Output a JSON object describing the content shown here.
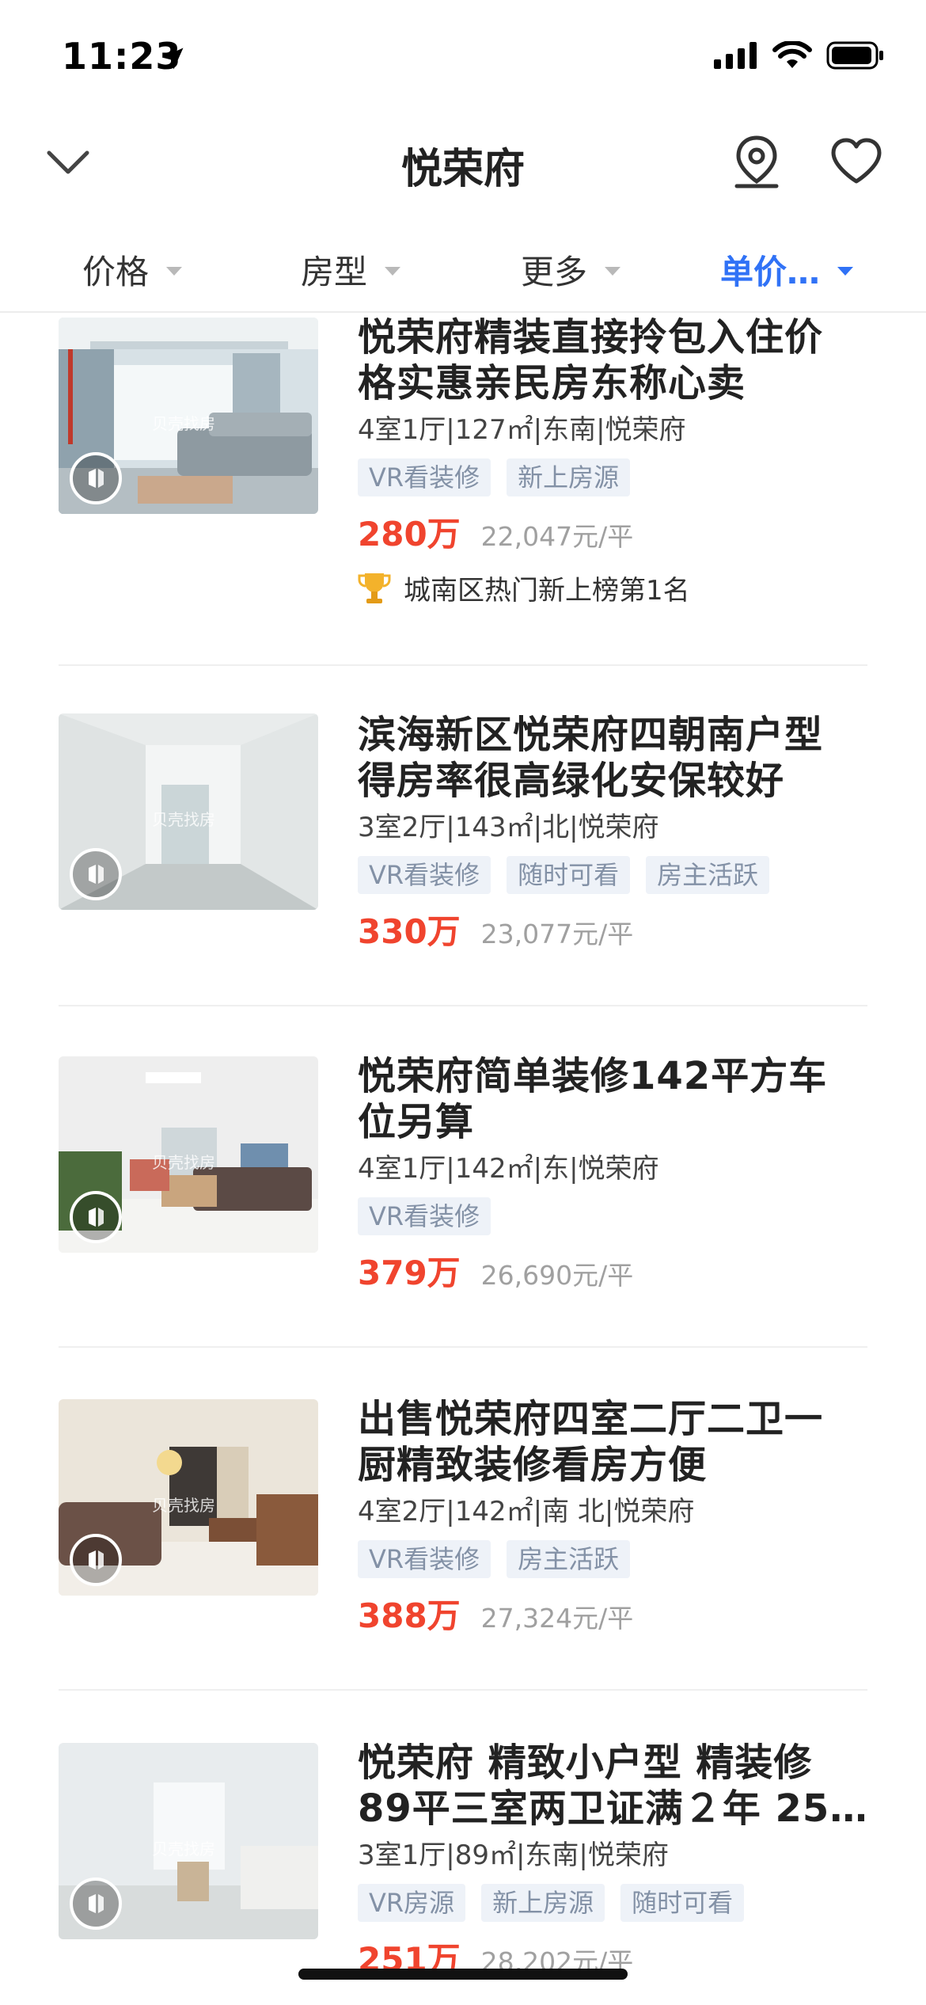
{
  "status_bar": {
    "time": "11:23"
  },
  "nav": {
    "title": "悦荣府"
  },
  "filters": [
    {
      "label": "价格",
      "active": false
    },
    {
      "label": "房型",
      "active": false
    },
    {
      "label": "更多",
      "active": false
    },
    {
      "label": "单价…",
      "active": true
    }
  ],
  "listings": [
    {
      "title_lines": [
        "悦荣府精装直接拎包入住价",
        "格实惠亲民房东称心卖"
      ],
      "meta": "4室1厅|127㎡|东南|悦荣府",
      "tags": [
        "VR看装修",
        "新上房源"
      ],
      "price": "280万",
      "unit_price": "22,047元/平",
      "rank": "城南区热门新上榜第1名"
    },
    {
      "title_lines": [
        "滨海新区悦荣府四朝南户型",
        "得房率很高绿化安保较好"
      ],
      "meta": "3室2厅|143㎡|北|悦荣府",
      "tags": [
        "VR看装修",
        "随时可看",
        "房主活跃"
      ],
      "price": "330万",
      "unit_price": "23,077元/平"
    },
    {
      "title_lines": [
        "悦荣府简单装修142平方车",
        "位另算"
      ],
      "meta": "4室1厅|142㎡|东|悦荣府",
      "tags": [
        "VR看装修"
      ],
      "price": "379万",
      "unit_price": "26,690元/平"
    },
    {
      "title_lines": [
        "出售悦荣府四室二厅二卫一",
        "厨精致装修看房方便"
      ],
      "meta": "4室2厅|142㎡|南 北|悦荣府",
      "tags": [
        "VR看装修",
        "房主活跃"
      ],
      "price": "388万",
      "unit_price": "27,324元/平"
    },
    {
      "title_lines": [
        "悦荣府 精致小户型 精装修",
        "89平三室两卫证满２年 25…"
      ],
      "meta": "3室1厅|89㎡|东南|悦荣府",
      "tags": [
        "VR房源",
        "新上房源",
        "随时可看"
      ],
      "price": "251万",
      "unit_price": "28,202元/平"
    }
  ],
  "watermark": "贝壳找房",
  "colors": {
    "accent": "#3072f6",
    "price": "#f0442e",
    "tag_bg": "#eef2f8",
    "tag_text": "#8391a6"
  }
}
